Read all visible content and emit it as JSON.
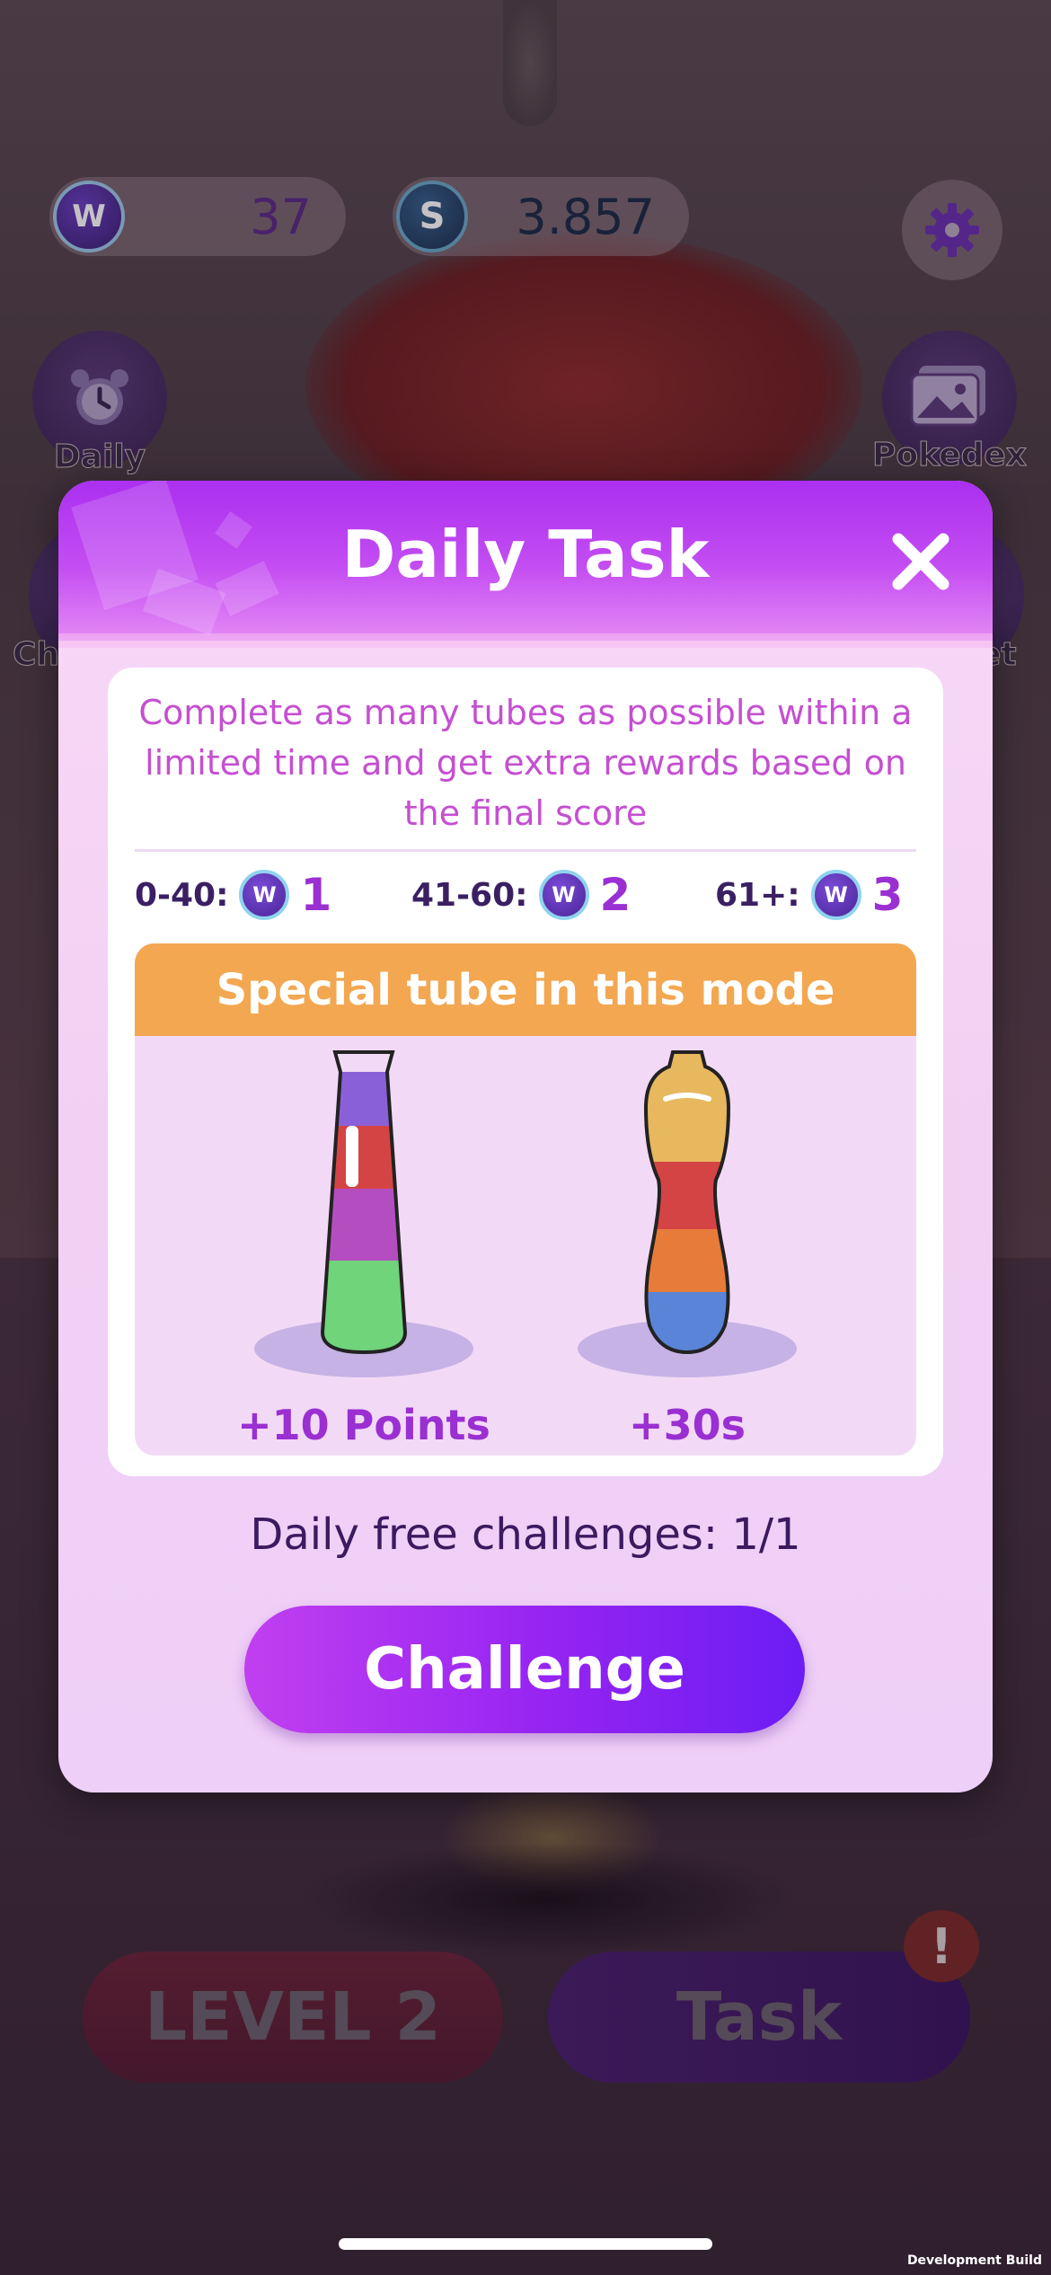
{
  "hud": {
    "gems": "37",
    "coins": "3.857",
    "gem_icon": "W",
    "coin_icon": "S"
  },
  "side_buttons": {
    "daily": "Daily",
    "pokedex": "Pokedex",
    "left_partial": "Ch",
    "right_partial": "et"
  },
  "bottom": {
    "level": "LEVEL 2",
    "task": "Task",
    "alert": "!"
  },
  "modal": {
    "title": "Daily Task",
    "description": "Complete as many tubes as possible within a limited time and get extra rewards based on the final score",
    "rewards": [
      {
        "range": "0-40:",
        "amount": "1"
      },
      {
        "range": "41-60:",
        "amount": "2"
      },
      {
        "range": "61+:",
        "amount": "3"
      }
    ],
    "special_header": "Special tube in this mode",
    "tubes": [
      {
        "caption": "+10 Points"
      },
      {
        "caption": "+30s"
      }
    ],
    "free_challenges": "Daily free challenges: 1/1",
    "challenge_button": "Challenge"
  },
  "footer": {
    "dev_build": "Development Build"
  },
  "colors": {
    "accent_purple": "#9524f2",
    "header_orange": "#f3a751",
    "text_pink": "#c54fd1"
  }
}
